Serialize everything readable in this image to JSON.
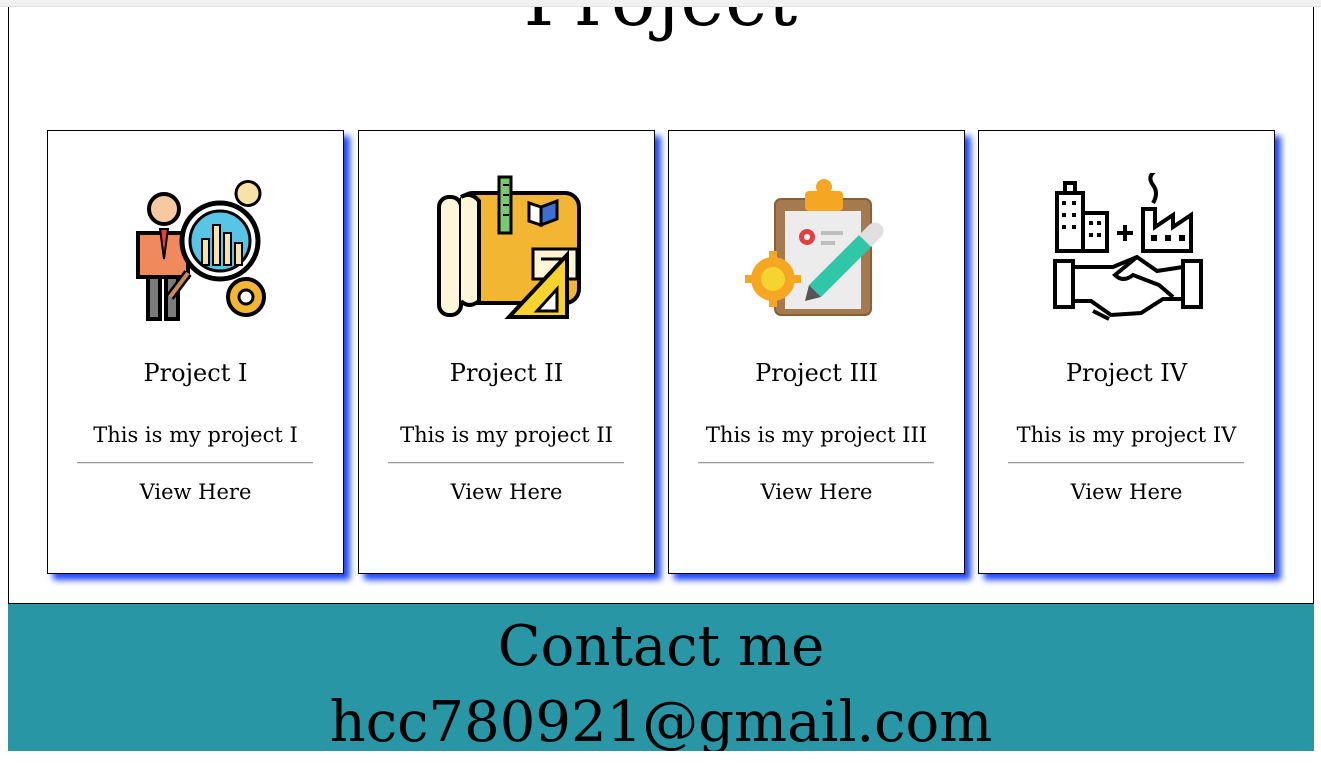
{
  "projects_section": {
    "title": "Project"
  },
  "projects": [
    {
      "name": "Project I",
      "description": "This is my project I",
      "link_label": "View Here",
      "icon": "analytics-person-icon"
    },
    {
      "name": "Project II",
      "description": "This is my project II",
      "link_label": "View Here",
      "icon": "blueprint-tools-icon"
    },
    {
      "name": "Project III",
      "description": "This is my project III",
      "link_label": "View Here",
      "icon": "clipboard-gear-icon"
    },
    {
      "name": "Project IV",
      "description": "This is my project IV",
      "link_label": "View Here",
      "icon": "handshake-industry-icon"
    }
  ],
  "contact": {
    "title": "Contact me",
    "email": "hcc780921@gmail.com",
    "background_color": "#2996a5"
  },
  "colors": {
    "card_shadow": "#1f48ff",
    "text": "#000000"
  }
}
